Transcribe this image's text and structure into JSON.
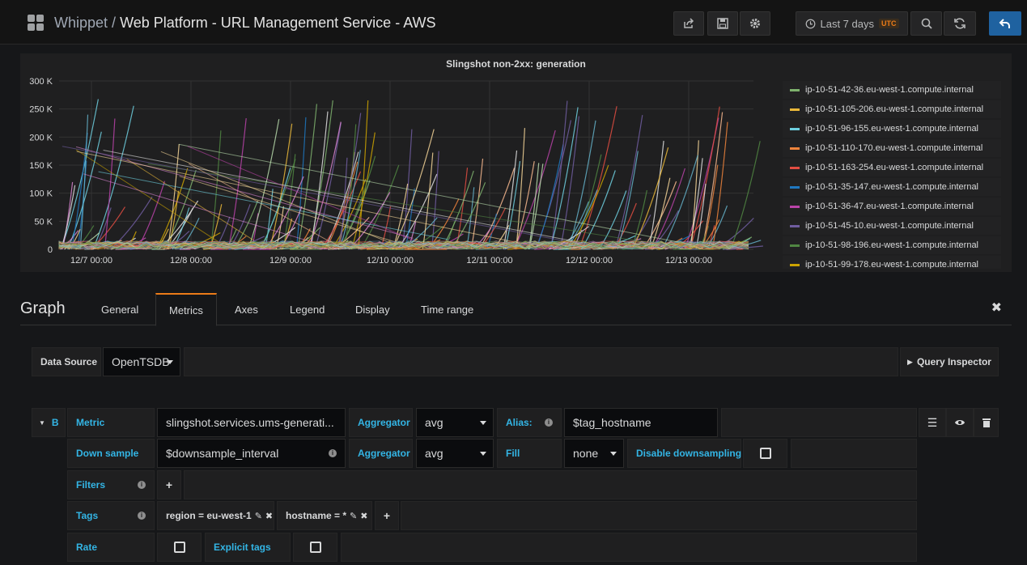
{
  "nav": {
    "folder": "Whippet /",
    "dashboard": "Web Platform - URL Management Service - AWS",
    "time_range": "Last 7 days",
    "timezone": "UTC"
  },
  "panel": {
    "title": "Slingshot non-2xx: generation"
  },
  "chart_data": {
    "type": "line",
    "title": "Slingshot non-2xx: generation",
    "x_ticks": [
      "12/7 00:00",
      "12/8 00:00",
      "12/9 00:00",
      "12/10 00:00",
      "12/11 00:00",
      "12/12 00:00",
      "12/13 00:00"
    ],
    "y_ticks": [
      "0",
      "50 K",
      "100 K",
      "150 K",
      "200 K",
      "250 K",
      "300 K"
    ],
    "ylim": [
      0,
      300000
    ],
    "grid": true,
    "legend_position": "right",
    "series": [
      {
        "name": "ip-10-51-42-36.eu-west-1.compute.internal",
        "color": "#7eb26d"
      },
      {
        "name": "ip-10-51-105-206.eu-west-1.compute.internal",
        "color": "#eab839"
      },
      {
        "name": "ip-10-51-96-155.eu-west-1.compute.internal",
        "color": "#6ed0e0"
      },
      {
        "name": "ip-10-51-110-170.eu-west-1.compute.internal",
        "color": "#ef843c"
      },
      {
        "name": "ip-10-51-163-254.eu-west-1.compute.internal",
        "color": "#e24d42"
      },
      {
        "name": "ip-10-51-35-147.eu-west-1.compute.internal",
        "color": "#1f78c1"
      },
      {
        "name": "ip-10-51-36-47.eu-west-1.compute.internal",
        "color": "#ba43a9"
      },
      {
        "name": "ip-10-51-45-10.eu-west-1.compute.internal",
        "color": "#705da0"
      },
      {
        "name": "ip-10-51-98-196.eu-west-1.compute.internal",
        "color": "#508642"
      },
      {
        "name": "ip-10-51-99-178.eu-west-1.compute.internal",
        "color": "#cca300"
      }
    ]
  },
  "editor": {
    "title": "Graph",
    "tabs": [
      "General",
      "Metrics",
      "Axes",
      "Legend",
      "Display",
      "Time range"
    ],
    "active_tab": "Metrics"
  },
  "datasource": {
    "label": "Data Source",
    "value": "OpenTSDB",
    "inspector": "Query Inspector"
  },
  "query": {
    "ref": "B",
    "metric_label": "Metric",
    "metric_value": "slingshot.services.ums-generati...",
    "aggregator_label": "Aggregator",
    "aggregator_value": "avg",
    "alias_label": "Alias:",
    "alias_value": "$tag_hostname",
    "downsample_label": "Down sample",
    "downsample_value": "$downsample_interval",
    "ds_aggregator_label": "Aggregator",
    "ds_aggregator_value": "avg",
    "fill_label": "Fill",
    "fill_value": "none",
    "disable_ds_label": "Disable downsampling",
    "filters_label": "Filters",
    "tags_label": "Tags",
    "tags": [
      "region = eu-west-1",
      "hostname = *"
    ],
    "rate_label": "Rate",
    "explicit_tags_label": "Explicit tags"
  }
}
